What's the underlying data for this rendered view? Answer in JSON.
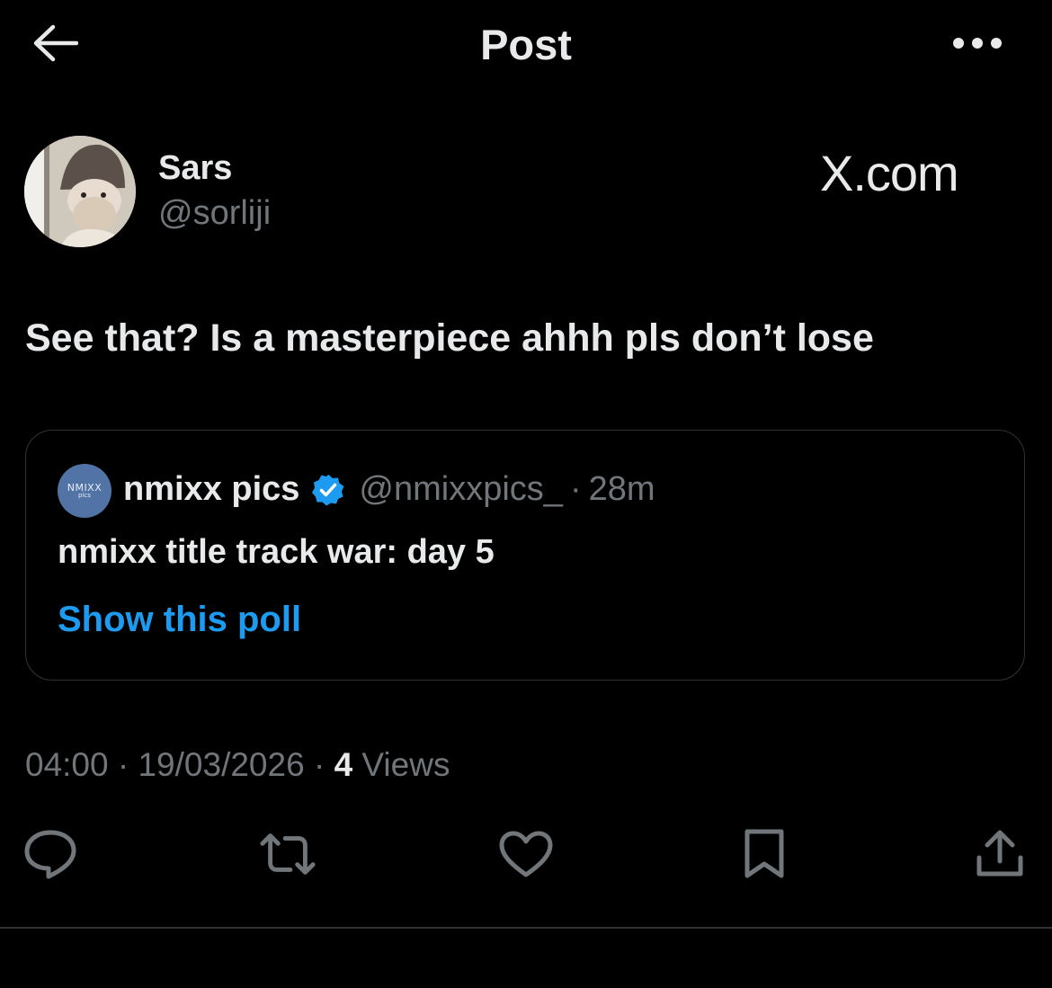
{
  "header": {
    "title": "Post"
  },
  "author": {
    "display_name": "Sars",
    "handle": "@sorliji",
    "watermark": "X.com"
  },
  "post": {
    "text": "See that? Is a masterpiece ahhh pls don’t lose"
  },
  "quote": {
    "avatar_text_top": "NMIXX",
    "avatar_text_bottom": "pics",
    "name": "nmixx pics",
    "verified": true,
    "handle": "@nmixxpics_",
    "separator": "·",
    "time": "28m",
    "text": "nmixx title track war: day 5",
    "poll_link": "Show this poll"
  },
  "meta": {
    "time": "04:00",
    "separator": "·",
    "date": "19/03/2026",
    "views_count": "4",
    "views_label": "Views"
  },
  "actions": {
    "reply": "reply-icon",
    "repost": "repost-icon",
    "like": "heart-icon",
    "bookmark": "bookmark-icon",
    "share": "share-icon"
  },
  "colors": {
    "background": "#000000",
    "text": "#e7e9ea",
    "secondary": "#71767b",
    "accent": "#1d9bf0",
    "border": "#2f3336"
  }
}
